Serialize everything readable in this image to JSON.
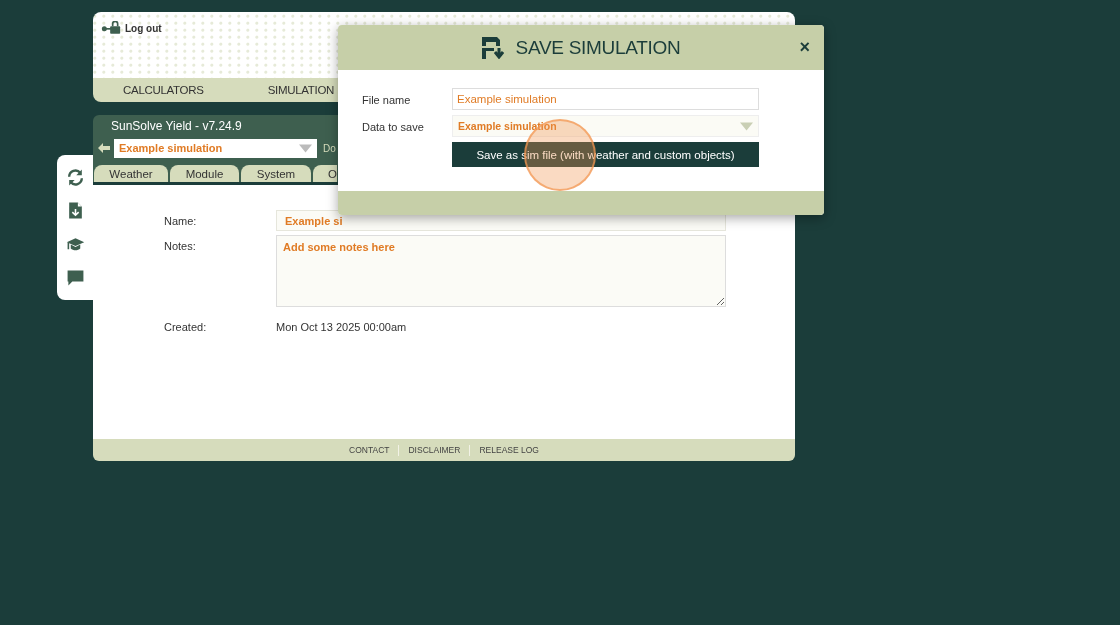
{
  "header": {
    "logout": "Log out"
  },
  "nav": [
    "CALCULATORS",
    "SIMULATION"
  ],
  "panel": {
    "title": "SunSolve Yield - v7.24.9",
    "selector": {
      "value": "Example simulation"
    },
    "next_label": "Do",
    "tabs": [
      {
        "label": "Weather",
        "selected": false
      },
      {
        "label": "Module",
        "selected": false
      },
      {
        "label": "System",
        "selected": false
      },
      {
        "label": "O",
        "selected": false
      }
    ],
    "form": {
      "name_label": "Name:",
      "name_value": "Example si",
      "notes_label": "Notes:",
      "notes_placeholder": "Add some notes here",
      "created_label": "Created:",
      "created_value": "Mon Oct 13 2025 00:00am"
    }
  },
  "footer": [
    "CONTACT",
    "DISCLAIMER",
    "RELEASE LOG"
  ],
  "side_toolbar": [
    {
      "kind": "refresh"
    },
    {
      "kind": "download"
    },
    {
      "kind": "learn"
    },
    {
      "kind": "chat"
    }
  ],
  "dialog": {
    "title": "SAVE SIMULATION",
    "close": "×",
    "file_name_label": "File name",
    "file_name": "Example simulation",
    "data_label": "Data to save",
    "data_value": "Example simulation",
    "button": "Save as sim file (with weather and custom objects)"
  }
}
